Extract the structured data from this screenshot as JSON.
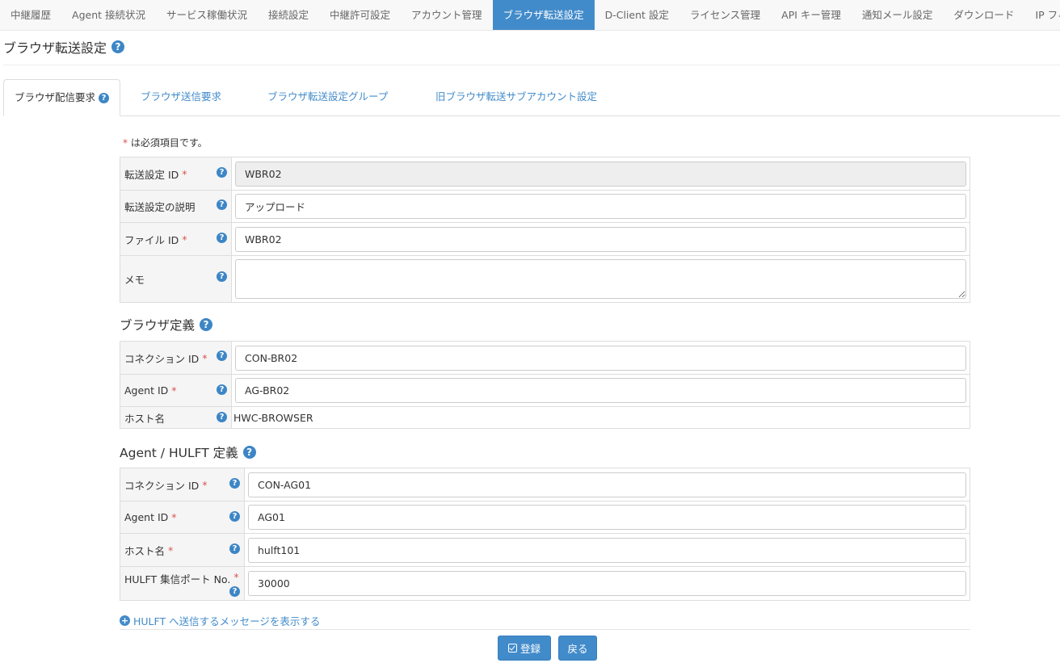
{
  "nav": {
    "items": [
      {
        "label": "中継履歴"
      },
      {
        "label": "Agent 接続状況"
      },
      {
        "label": "サービス稼働状況"
      },
      {
        "label": "接続設定"
      },
      {
        "label": "中継許可設定"
      },
      {
        "label": "アカウント管理"
      },
      {
        "label": "ブラウザ転送設定",
        "active": true
      },
      {
        "label": "D-Client 設定"
      },
      {
        "label": "ライセンス管理"
      },
      {
        "label": "API キー管理"
      },
      {
        "label": "通知メール設定"
      },
      {
        "label": "ダウンロード"
      },
      {
        "label": "IP フィルタ"
      }
    ]
  },
  "page": {
    "title": "ブラウザ転送設定",
    "help_glyph": "?"
  },
  "tabs": [
    {
      "label": "ブラウザ配信要求",
      "active": true
    },
    {
      "label": "ブラウザ送信要求"
    },
    {
      "label": "ブラウザ転送設定グループ"
    },
    {
      "label": "旧ブラウザ転送サブアカウント設定"
    }
  ],
  "form": {
    "required_mark": "*",
    "required_note": "は必須項目です。",
    "basic": [
      {
        "label": "転送設定 ID",
        "required": true,
        "value": "WBR02",
        "readonly": true
      },
      {
        "label": "転送設定の説明",
        "required": false,
        "value": "アップロード"
      },
      {
        "label": "ファイル ID",
        "required": true,
        "value": "WBR02"
      },
      {
        "label": "メモ",
        "required": false,
        "value": ""
      }
    ],
    "browser_section": {
      "heading": "ブラウザ定義",
      "rows": [
        {
          "label": "コネクション ID",
          "required": true,
          "value": "CON-BR02"
        },
        {
          "label": "Agent ID",
          "required": true,
          "value": "AG-BR02"
        },
        {
          "label": "ホスト名",
          "required": false,
          "value": "HWC-BROWSER"
        }
      ]
    },
    "agent_section": {
      "heading": "Agent / HULFT 定義",
      "rows": [
        {
          "label": "コネクション ID",
          "required": true,
          "value": "CON-AG01"
        },
        {
          "label": "Agent ID",
          "required": true,
          "value": "AG01"
        },
        {
          "label": "ホスト名",
          "required": true,
          "value": "hulft101"
        },
        {
          "label": "HULFT 集信ポート No.",
          "required": true,
          "value": "30000"
        }
      ]
    }
  },
  "footer": {
    "show_message_link": "HULFT へ送信するメッセージを表示する",
    "plus_glyph": "+",
    "register_button": "登録",
    "back_button": "戻る"
  },
  "colors": {
    "accent": "#428bca",
    "required": "#d9534f",
    "help_icon": "#3d86c6"
  }
}
